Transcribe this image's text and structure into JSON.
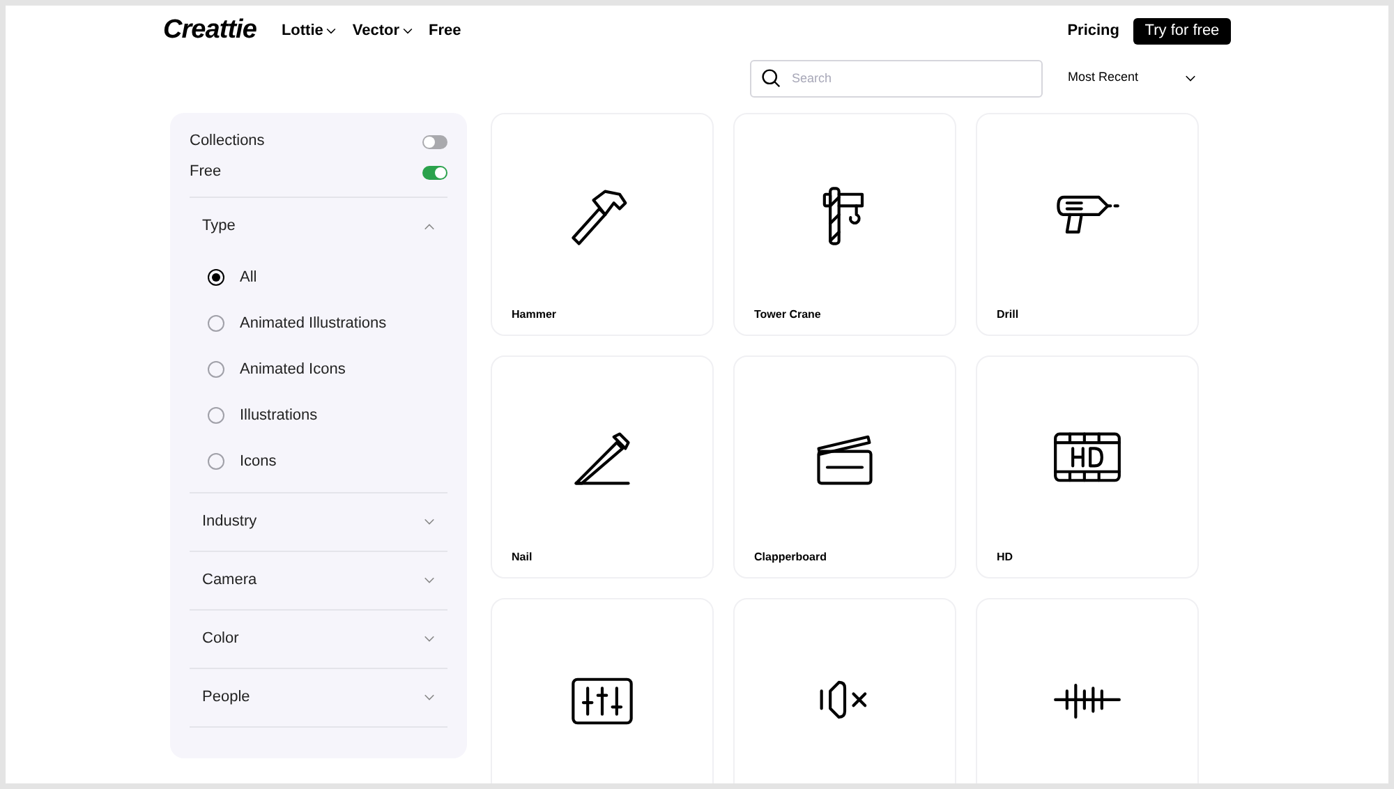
{
  "header": {
    "logo": "Creattie",
    "nav": [
      {
        "label": "Lottie",
        "dropdown": true
      },
      {
        "label": "Vector",
        "dropdown": true
      },
      {
        "label": "Free",
        "dropdown": false
      }
    ],
    "pricing": "Pricing",
    "cta": "Try for free"
  },
  "search": {
    "placeholder": "Search"
  },
  "sort": {
    "value": "Most Recent"
  },
  "sidebar": {
    "toggles": [
      {
        "label": "Collections",
        "on": false
      },
      {
        "label": "Free",
        "on": true
      }
    ],
    "sections": [
      {
        "title": "Type",
        "expanded": true,
        "options": [
          {
            "label": "All",
            "selected": true
          },
          {
            "label": "Animated Illustrations",
            "selected": false
          },
          {
            "label": "Animated Icons",
            "selected": false
          },
          {
            "label": "Illustrations",
            "selected": false
          },
          {
            "label": "Icons",
            "selected": false
          }
        ]
      },
      {
        "title": "Industry",
        "expanded": false
      },
      {
        "title": "Camera",
        "expanded": false
      },
      {
        "title": "Color",
        "expanded": false
      },
      {
        "title": "People",
        "expanded": false
      }
    ]
  },
  "cards": [
    {
      "kind": "hammer",
      "name": "Hammer"
    },
    {
      "kind": "crane",
      "name": "Tower Crane"
    },
    {
      "kind": "drill",
      "name": "Drill"
    },
    {
      "kind": "nail",
      "name": "Nail"
    },
    {
      "kind": "clapperboard",
      "name": "Clapperboard"
    },
    {
      "kind": "film",
      "name": "HD"
    },
    {
      "kind": "equalizer"
    },
    {
      "kind": "muted"
    },
    {
      "kind": "wave"
    }
  ]
}
